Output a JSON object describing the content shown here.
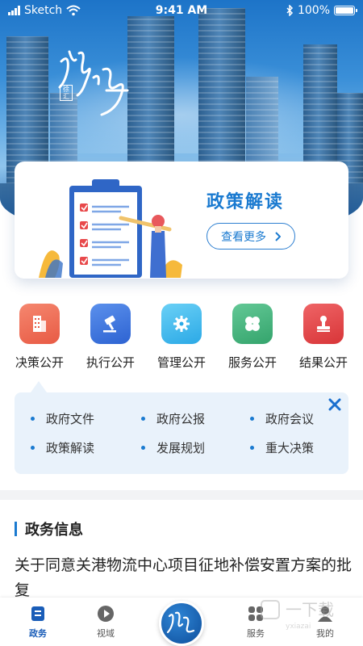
{
  "status_bar": {
    "carrier": "Sketch",
    "time": "9:41 AM",
    "battery": "100%"
  },
  "hero": {
    "logo_alt": "徐汇",
    "seal_text": "徐汇"
  },
  "policy_card": {
    "title": "政策解读",
    "more_label": "查看更多"
  },
  "categories": [
    {
      "label": "决策公开",
      "icon": "building-icon",
      "color": "#ef6f58"
    },
    {
      "label": "执行公开",
      "icon": "gavel-icon",
      "color": "#3f78e0"
    },
    {
      "label": "管理公开",
      "icon": "gear-icon",
      "color": "#3fb9ee"
    },
    {
      "label": "服务公开",
      "icon": "clover-icon",
      "color": "#45b47f"
    },
    {
      "label": "结果公开",
      "icon": "stamp-icon",
      "color": "#e8494b"
    }
  ],
  "sub_items": [
    "政府文件",
    "政府公报",
    "政府会议",
    "政策解读",
    "发展规划",
    "重大决策"
  ],
  "news": {
    "section_title": "政务信息",
    "headline": "关于同意关港物流中心项目征地补偿安置方案的批复"
  },
  "tabbar": {
    "tabs": [
      {
        "label": "政务",
        "icon": "document-icon"
      },
      {
        "label": "视域",
        "icon": "play-icon"
      },
      {
        "label": "服务",
        "icon": "grid-icon"
      },
      {
        "label": "我的",
        "icon": "user-icon"
      }
    ],
    "active": "政务"
  },
  "colors": {
    "accent": "#1a7ad0",
    "tab_active": "#1a5db8",
    "panel_bg": "#e9f2fb"
  }
}
